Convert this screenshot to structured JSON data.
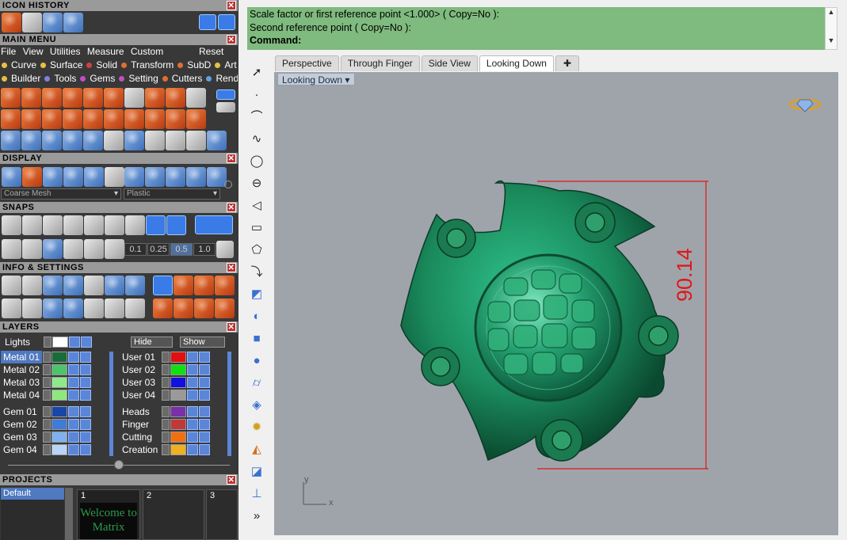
{
  "left_panel": {
    "icon_history": {
      "title": "ICON HISTORY"
    },
    "main_menu": {
      "title": "MAIN MENU",
      "menus": [
        "File",
        "View",
        "Utilities",
        "Measure",
        "Custom"
      ],
      "reset": "Reset",
      "row1": [
        {
          "label": "Curve",
          "color": "#e8c040"
        },
        {
          "label": "Surface",
          "color": "#e8c040"
        },
        {
          "label": "Solid",
          "color": "#d04040"
        },
        {
          "label": "Transform",
          "color": "#e07030"
        },
        {
          "label": "SubD",
          "color": "#e07030"
        },
        {
          "label": "Art",
          "color": "#e8c040"
        }
      ],
      "row2": [
        {
          "label": "Builder",
          "color": "#e8c040"
        },
        {
          "label": "Tools",
          "color": "#8080e0"
        },
        {
          "label": "Gems",
          "color": "#c050c0"
        },
        {
          "label": "Setting",
          "color": "#c050c0"
        },
        {
          "label": "Cutters",
          "color": "#e07030"
        },
        {
          "label": "Render",
          "color": "#60a0e0"
        }
      ]
    },
    "display": {
      "title": "DISPLAY",
      "mesh": "Coarse Mesh",
      "material": "Plastic"
    },
    "snaps": {
      "title": "SNAPS",
      "values": [
        "0.1",
        "0.25",
        "0.5",
        "1.0"
      ]
    },
    "info": {
      "title": "INFO & SETTINGS"
    },
    "layers": {
      "title": "LAYERS",
      "lights": "Lights",
      "hide": "Hide",
      "show": "Show",
      "left": [
        {
          "name": "Metal 01",
          "color": "#1a6b3a"
        },
        {
          "name": "Metal 02",
          "color": "#4bc56a"
        },
        {
          "name": "Metal 03",
          "color": "#8fe88a"
        },
        {
          "name": "Metal 04",
          "color": "#8ee87e"
        },
        {
          "name": "Gem 01",
          "color": "#1846a8"
        },
        {
          "name": "Gem 02",
          "color": "#3f7bd8"
        },
        {
          "name": "Gem 03",
          "color": "#7fb0f0"
        },
        {
          "name": "Gem 04",
          "color": "#b9d5f5"
        }
      ],
      "right": [
        {
          "name": "User 01",
          "color": "#e01010"
        },
        {
          "name": "User 02",
          "color": "#10e010"
        },
        {
          "name": "User 03",
          "color": "#1010e0"
        },
        {
          "name": "User 04",
          "color": "#9a9a9a"
        },
        {
          "name": "Heads",
          "color": "#7a30a8"
        },
        {
          "name": "Finger",
          "color": "#c03838"
        },
        {
          "name": "Cutting",
          "color": "#f07010"
        },
        {
          "name": "Creation",
          "color": "#f0b020"
        }
      ]
    },
    "projects": {
      "title": "PROJECTS",
      "default": "Default",
      "slots": [
        "1",
        "2",
        "3"
      ],
      "thumb_text": "Welcome to Matrix"
    }
  },
  "command": {
    "line1": "Scale factor or first reference point <1.000> ( Copy=No ):",
    "line2": "Second reference point ( Copy=No ):",
    "line3": "Command:"
  },
  "tabs": [
    "Perspective",
    "Through Finger",
    "Side View",
    "Looking Down"
  ],
  "active_tab": "Looking Down",
  "viewport": {
    "label": "Looking Down",
    "dimension": "90.14",
    "axis_y": "y",
    "axis_x": "x",
    "background": "#9fa4ab",
    "model_color": "#1e8a5a",
    "dimension_color": "#e01818"
  },
  "side_toolbar": {
    "more": "»"
  }
}
